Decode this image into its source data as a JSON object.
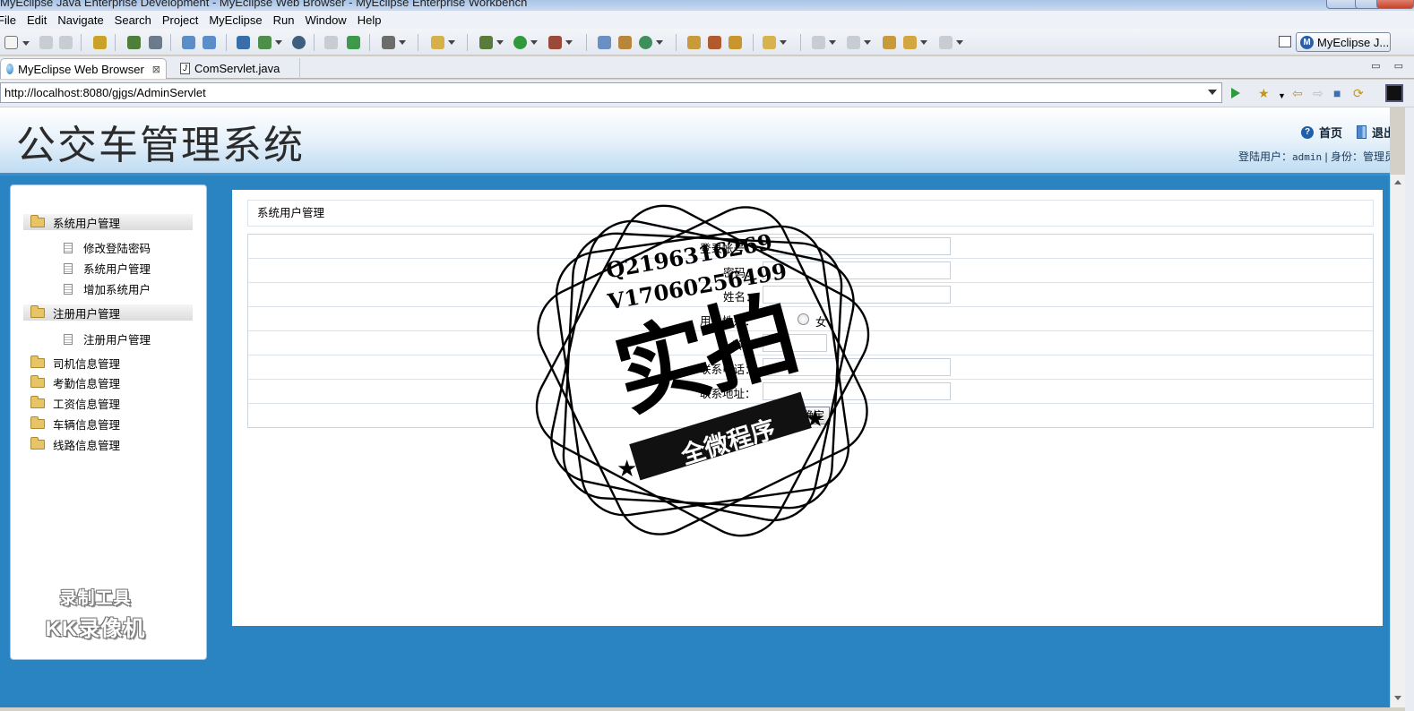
{
  "window": {
    "title": "MyEclipse Java Enterprise Development - MyEclipse Web Browser - MyEclipse Enterprise Workbench"
  },
  "menu": [
    "File",
    "Edit",
    "Navigate",
    "Search",
    "Project",
    "MyEclipse",
    "Run",
    "Window",
    "Help"
  ],
  "toolbar": {
    "perspective_label": "MyEclipse J...",
    "perspective_icon": "myeclipse-icon"
  },
  "tabs": [
    {
      "label": "MyEclipse Web Browser",
      "active": true,
      "icon": "globe-icon",
      "close": "⊠"
    },
    {
      "label": "ComServlet.java",
      "active": false,
      "icon": "java-file-icon"
    }
  ],
  "tab_controls": "▭ ▭",
  "address": {
    "url": "http://localhost:8080/gjgs/AdminServlet"
  },
  "site": {
    "title": "公交车管理系统",
    "links": {
      "home": "首页",
      "logout": "退出"
    },
    "user_prefix": "登陆用户：",
    "user_name": "admin",
    "separator": "|",
    "role_prefix": "身份：",
    "role": "管理员"
  },
  "sidebar": {
    "groups": [
      {
        "label": "系统用户管理",
        "open": true,
        "items": [
          "修改登陆密码",
          "系统用户管理",
          "增加系统用户"
        ]
      },
      {
        "label": "注册用户管理",
        "open": true,
        "items": [
          "注册用户管理"
        ]
      },
      {
        "label": "司机信息管理",
        "open": false,
        "items": []
      },
      {
        "label": "考勤信息管理",
        "open": false,
        "items": []
      },
      {
        "label": "工资信息管理",
        "open": false,
        "items": []
      },
      {
        "label": "车辆信息管理",
        "open": false,
        "items": []
      },
      {
        "label": "线路信息管理",
        "open": false,
        "items": []
      }
    ],
    "recorder_watermark": {
      "line1": "录制工具",
      "line2": "KK录像机"
    }
  },
  "main": {
    "title": "系统用户管理",
    "form": {
      "account_label": "登录帐号：",
      "password_label": "密码：",
      "name_label": "姓名：",
      "gender_label": "用户性别：",
      "gender_female": "女",
      "age_label": "龄：",
      "phone_label": "联系电话：",
      "address_label": "联系地址：",
      "submit_label": "确定"
    }
  },
  "stamp": {
    "qq": "Q2196316269",
    "vx": "V17060256499",
    "big": "实拍",
    "ribbon": "全微程序",
    "star": "★"
  },
  "colors": {
    "page_bg": "#2a84c2",
    "header_border": "#3b8fcf"
  }
}
